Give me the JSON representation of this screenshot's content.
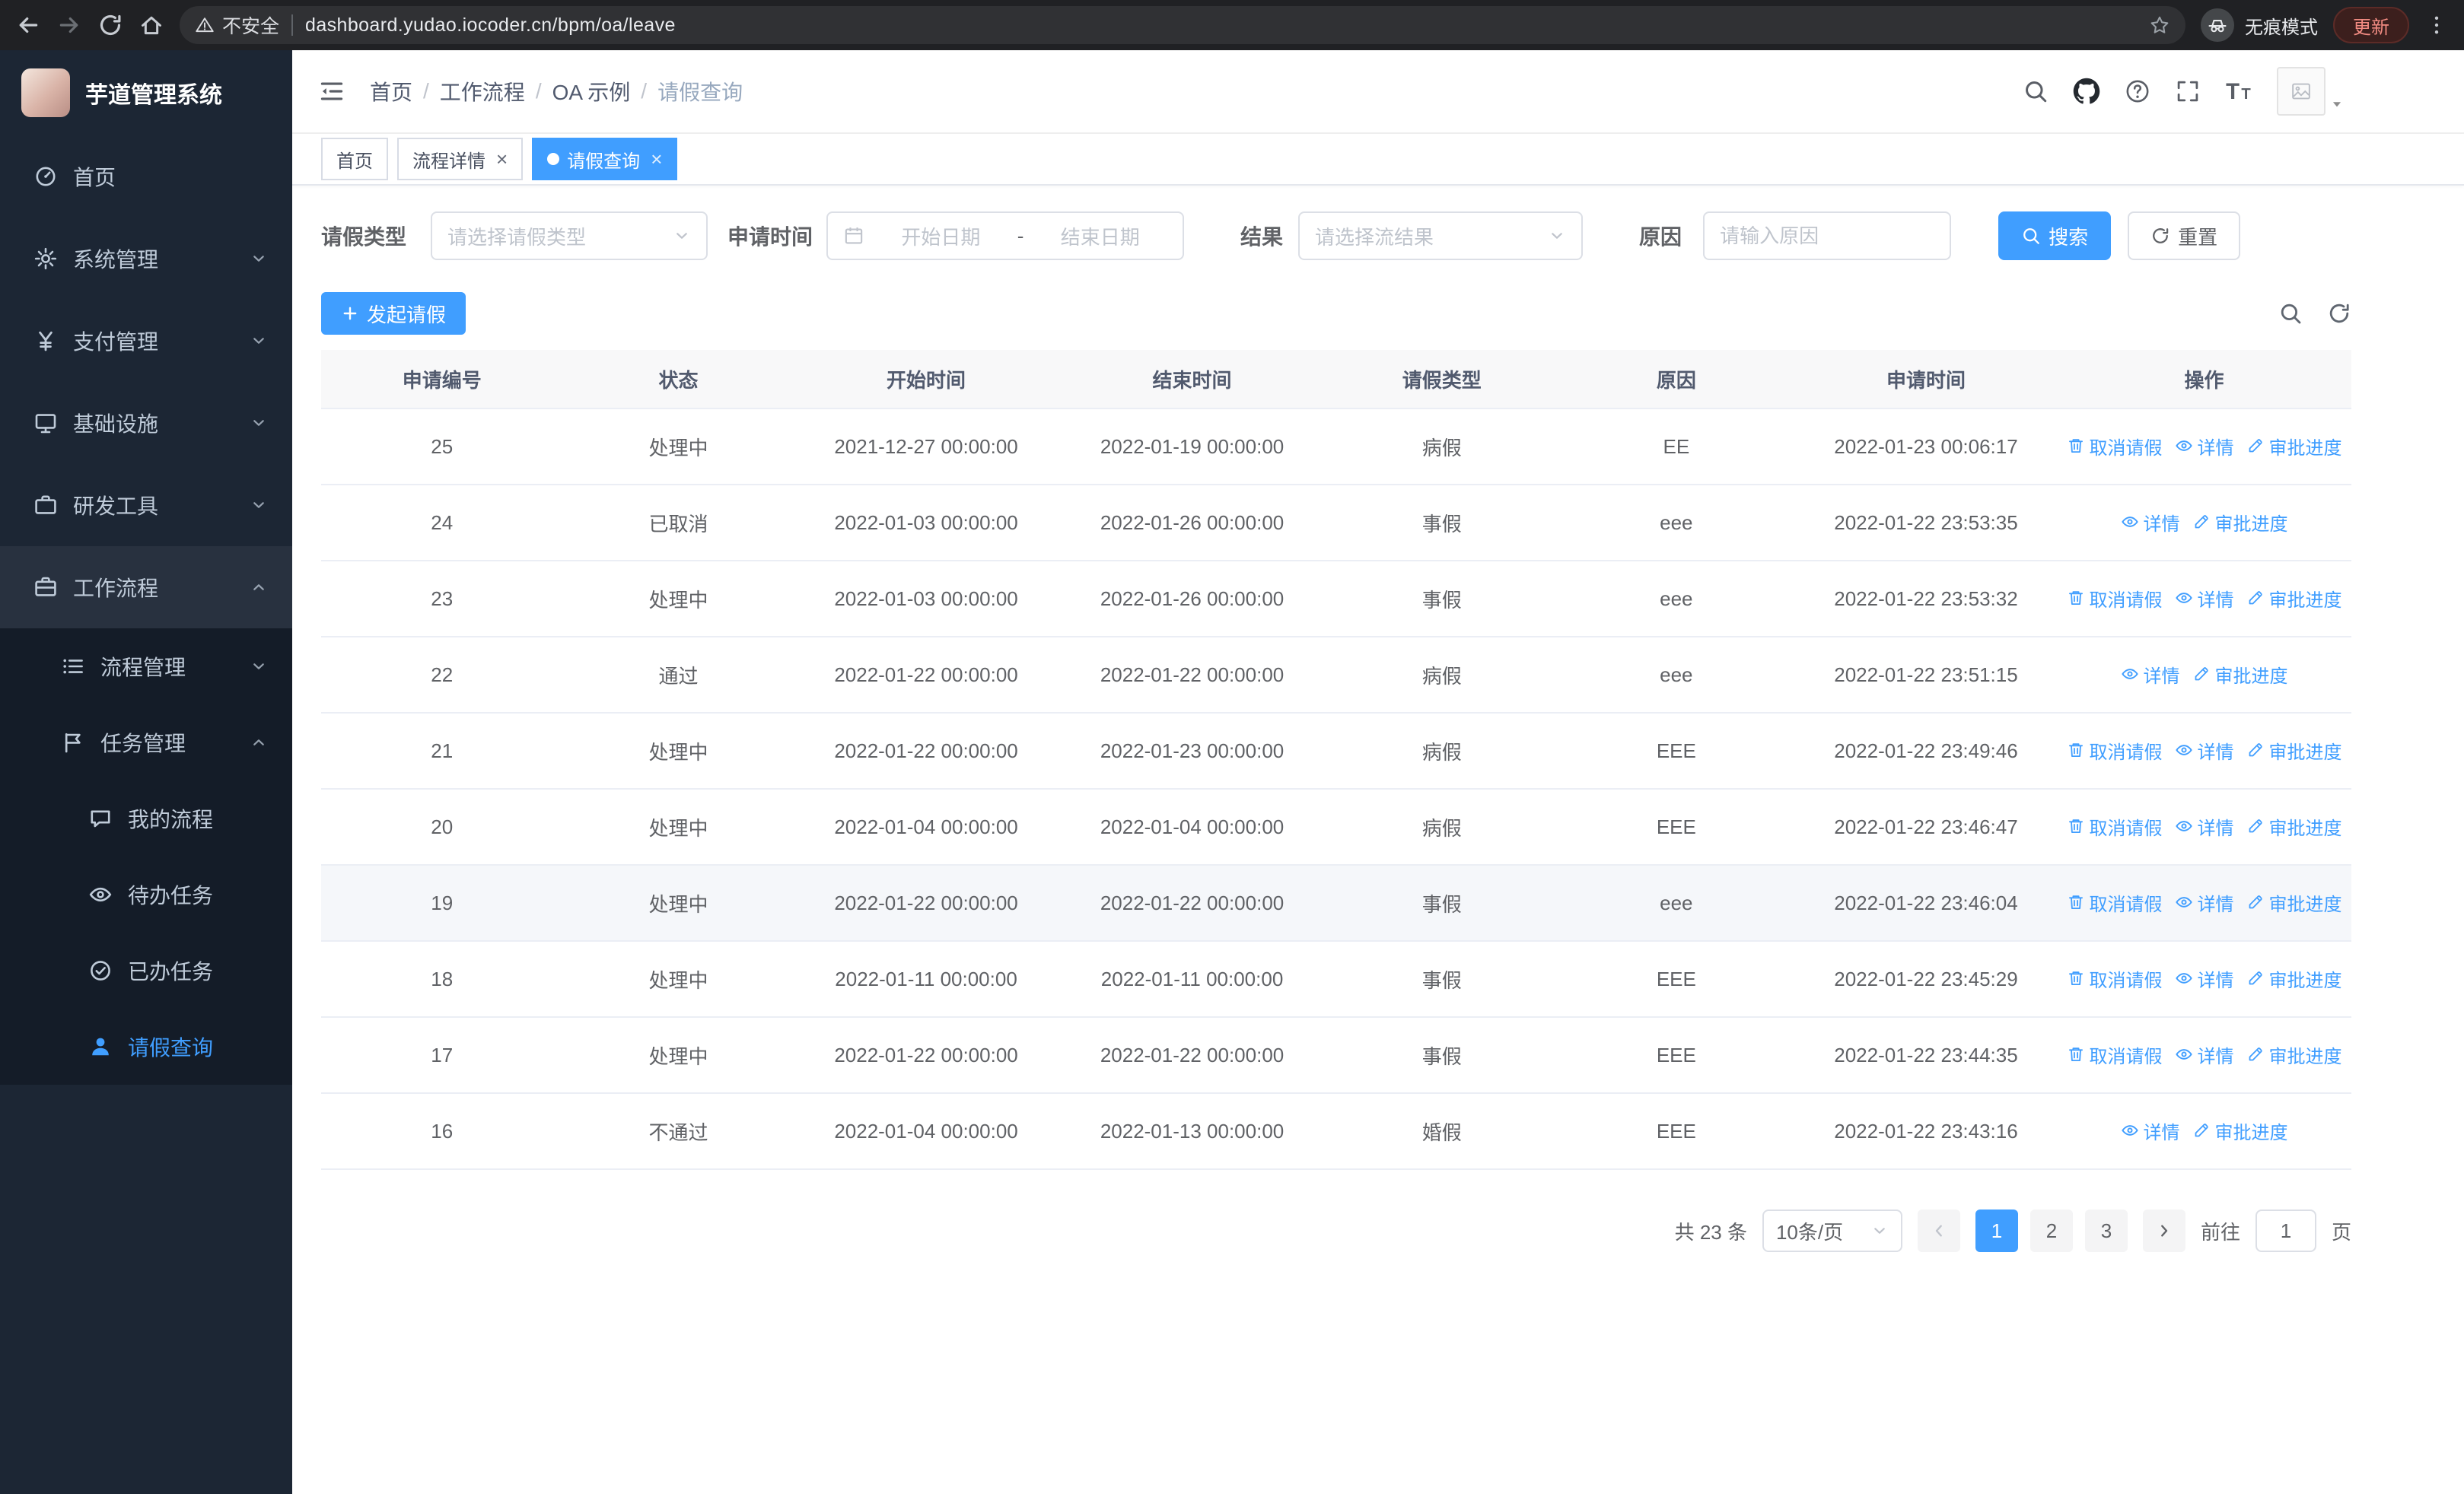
{
  "browser": {
    "security_warning": "不安全",
    "url": "dashboard.yudao.iocoder.cn/bpm/oa/leave",
    "incognito_label": "无痕模式",
    "update_button": "更新"
  },
  "sidebar": {
    "logo_title": "芋道管理系统",
    "menu": [
      {
        "name": "home",
        "label": "首页",
        "icon": "dashboard-icon"
      },
      {
        "name": "system-mgmt",
        "label": "系统管理",
        "icon": "gear-icon",
        "expandable": true
      },
      {
        "name": "payment-mgmt",
        "label": "支付管理",
        "icon": "payment-icon",
        "expandable": true
      },
      {
        "name": "infrastructure",
        "label": "基础设施",
        "icon": "infrastructure-icon",
        "expandable": true
      },
      {
        "name": "dev-tools",
        "label": "研发工具",
        "icon": "devtools-icon",
        "expandable": true
      },
      {
        "name": "workflow",
        "label": "工作流程",
        "icon": "workflow-icon",
        "expandable": true,
        "expanded": true,
        "children": [
          {
            "name": "process-mgmt",
            "label": "流程管理",
            "icon": "process-icon",
            "expandable": true
          },
          {
            "name": "task-mgmt",
            "label": "任务管理",
            "icon": "task-icon",
            "expandable": true,
            "expanded": true,
            "children": [
              {
                "name": "my-process",
                "label": "我的流程",
                "icon": "my-process-icon"
              },
              {
                "name": "todo-tasks",
                "label": "待办任务",
                "icon": "todo-eye-icon"
              },
              {
                "name": "done-tasks",
                "label": "已办任务",
                "icon": "done-icon"
              },
              {
                "name": "leave-query",
                "label": "请假查询",
                "icon": "user-icon",
                "active": true
              }
            ]
          }
        ]
      }
    ]
  },
  "header": {
    "breadcrumb": [
      "首页",
      "工作流程",
      "OA 示例",
      "请假查询"
    ]
  },
  "tabs": [
    {
      "name": "home",
      "label": "首页"
    },
    {
      "name": "process-detail",
      "label": "流程详情",
      "closable": true
    },
    {
      "name": "leave-query",
      "label": "请假查询",
      "closable": true,
      "active": true
    }
  ],
  "filters": {
    "leave_type_label": "请假类型",
    "leave_type_placeholder": "请选择请假类型",
    "apply_time_label": "申请时间",
    "start_date_placeholder": "开始日期",
    "range_separator": "-",
    "end_date_placeholder": "结束日期",
    "result_label": "结果",
    "result_placeholder": "请选择流结果",
    "reason_label": "原因",
    "reason_placeholder": "请输入原因",
    "search_button": "搜索",
    "reset_button": "重置"
  },
  "toolbar": {
    "create_button": "发起请假"
  },
  "table": {
    "columns": [
      "申请编号",
      "状态",
      "开始时间",
      "结束时间",
      "请假类型",
      "原因",
      "申请时间",
      "操作"
    ],
    "action_defs": {
      "cancel": {
        "label": "取消请假",
        "icon": "trash-icon"
      },
      "detail": {
        "label": "详情",
        "icon": "eye-icon"
      },
      "progress": {
        "label": "审批进度",
        "icon": "edit-icon"
      }
    },
    "rows": [
      {
        "id": "25",
        "status": "处理中",
        "start": "2021-12-27 00:00:00",
        "end": "2022-01-19 00:00:00",
        "type": "病假",
        "reason": "EE",
        "apply_time": "2022-01-23 00:06:17",
        "actions": [
          "cancel",
          "detail",
          "progress"
        ]
      },
      {
        "id": "24",
        "status": "已取消",
        "start": "2022-01-03 00:00:00",
        "end": "2022-01-26 00:00:00",
        "type": "事假",
        "reason": "eee",
        "apply_time": "2022-01-22 23:53:35",
        "actions": [
          "detail",
          "progress"
        ]
      },
      {
        "id": "23",
        "status": "处理中",
        "start": "2022-01-03 00:00:00",
        "end": "2022-01-26 00:00:00",
        "type": "事假",
        "reason": "eee",
        "apply_time": "2022-01-22 23:53:32",
        "actions": [
          "cancel",
          "detail",
          "progress"
        ]
      },
      {
        "id": "22",
        "status": "通过",
        "start": "2022-01-22 00:00:00",
        "end": "2022-01-22 00:00:00",
        "type": "病假",
        "reason": "eee",
        "apply_time": "2022-01-22 23:51:15",
        "actions": [
          "detail",
          "progress"
        ]
      },
      {
        "id": "21",
        "status": "处理中",
        "start": "2022-01-22 00:00:00",
        "end": "2022-01-23 00:00:00",
        "type": "病假",
        "reason": "EEE",
        "apply_time": "2022-01-22 23:49:46",
        "actions": [
          "cancel",
          "detail",
          "progress"
        ]
      },
      {
        "id": "20",
        "status": "处理中",
        "start": "2022-01-04 00:00:00",
        "end": "2022-01-04 00:00:00",
        "type": "病假",
        "reason": "EEE",
        "apply_time": "2022-01-22 23:46:47",
        "actions": [
          "cancel",
          "detail",
          "progress"
        ]
      },
      {
        "id": "19",
        "status": "处理中",
        "start": "2022-01-22 00:00:00",
        "end": "2022-01-22 00:00:00",
        "type": "事假",
        "reason": "eee",
        "apply_time": "2022-01-22 23:46:04",
        "actions": [
          "cancel",
          "detail",
          "progress"
        ],
        "highlighted": true
      },
      {
        "id": "18",
        "status": "处理中",
        "start": "2022-01-11 00:00:00",
        "end": "2022-01-11 00:00:00",
        "type": "事假",
        "reason": "EEE",
        "apply_time": "2022-01-22 23:45:29",
        "actions": [
          "cancel",
          "detail",
          "progress"
        ]
      },
      {
        "id": "17",
        "status": "处理中",
        "start": "2022-01-22 00:00:00",
        "end": "2022-01-22 00:00:00",
        "type": "事假",
        "reason": "EEE",
        "apply_time": "2022-01-22 23:44:35",
        "actions": [
          "cancel",
          "detail",
          "progress"
        ]
      },
      {
        "id": "16",
        "status": "不通过",
        "start": "2022-01-04 00:00:00",
        "end": "2022-01-13 00:00:00",
        "type": "婚假",
        "reason": "EEE",
        "apply_time": "2022-01-22 23:43:16",
        "actions": [
          "detail",
          "progress"
        ]
      }
    ]
  },
  "pagination": {
    "total_text": "共 23 条",
    "page_size": "10条/页",
    "pages": [
      "1",
      "2",
      "3"
    ],
    "active_page": "1",
    "goto_label": "前往",
    "goto_value": "1",
    "goto_suffix": "页"
  },
  "colors": {
    "primary": "#409eff",
    "sidebar_bg": "#1c2634",
    "submenu_bg": "#141c28",
    "table_header_bg": "#f8f8f9",
    "hover_row_bg": "#f5f7fa",
    "update_button_text": "#f28b82"
  }
}
